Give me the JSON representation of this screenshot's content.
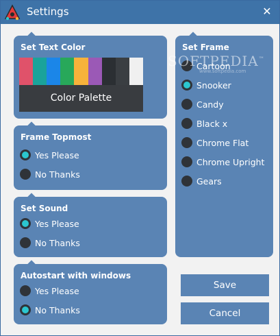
{
  "window": {
    "title": "Settings",
    "close_glyph": "✕"
  },
  "text_color": {
    "title": "Set Text Color",
    "swatches": [
      "#e0526a",
      "#1aa39a",
      "#1b86e8",
      "#28a85a",
      "#f7b23b",
      "#9b59b6",
      "#2b2f33",
      "#3a3e42",
      "#f0f0f0"
    ],
    "palette_label": "Color Palette"
  },
  "topmost": {
    "title": "Frame Topmost",
    "options": [
      {
        "label": "Yes Please",
        "checked": true
      },
      {
        "label": "No Thanks",
        "checked": false
      }
    ]
  },
  "sound": {
    "title": "Set Sound",
    "options": [
      {
        "label": "Yes Please",
        "checked": true
      },
      {
        "label": "No Thanks",
        "checked": false
      }
    ]
  },
  "autostart": {
    "title": "Autostart with windows",
    "options": [
      {
        "label": "Yes Please",
        "checked": false
      },
      {
        "label": "No Thanks",
        "checked": true
      }
    ]
  },
  "frame": {
    "title": "Set Frame",
    "options": [
      {
        "label": "Cartoon",
        "checked": false
      },
      {
        "label": "Snooker",
        "checked": true
      },
      {
        "label": "Candy",
        "checked": false
      },
      {
        "label": "Black x",
        "checked": false
      },
      {
        "label": "Chrome Flat",
        "checked": false
      },
      {
        "label": "Chrome Upright",
        "checked": false
      },
      {
        "label": "Gears",
        "checked": false
      }
    ]
  },
  "actions": {
    "save_label": "Save",
    "cancel_label": "Cancel"
  },
  "watermark": {
    "text": "SOFTPEDIA",
    "tm": "™",
    "sub": "www.softpedia.com"
  },
  "colors": {
    "titlebar": "#3e73a8",
    "panel": "#5a84b4",
    "radio_fill": "#2f3338",
    "radio_checked": "#2bc6cf",
    "window_bg": "#f2f2f2"
  }
}
